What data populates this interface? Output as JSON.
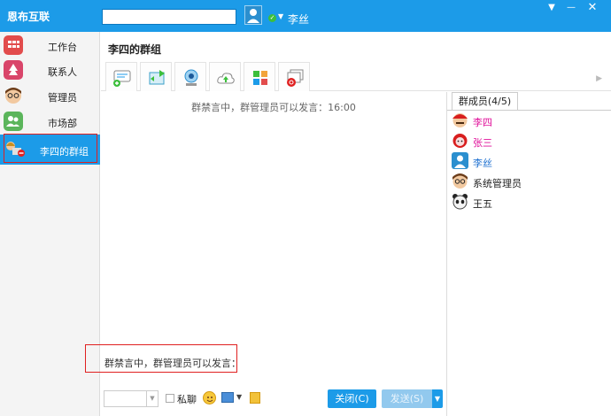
{
  "app": {
    "title": "恩布互联"
  },
  "header": {
    "user_name": "李丝",
    "search_value": ""
  },
  "window": {
    "menu": "▼",
    "minimize": "—",
    "close": "✕"
  },
  "sidebar": {
    "items": [
      {
        "label": "工作台",
        "icon": "grid-app-icon",
        "color": "#e24c4c"
      },
      {
        "label": "联系人",
        "icon": "tree-contacts-icon",
        "color": "#d9456a"
      },
      {
        "label": "管理员",
        "icon": "admin-avatar-icon",
        "color": "#8a5a2b"
      },
      {
        "label": "市场部",
        "icon": "group-people-icon",
        "color": "#5bb55b"
      },
      {
        "label": "李四的群组",
        "icon": "group-forbidden-icon",
        "color": "#1c9be8",
        "active": true
      }
    ]
  },
  "chat": {
    "group_title": "李四的群组",
    "notice": "群禁言中，群管理员可以发言：16:00",
    "input_text": "群禁言中，群管理员可以发言：",
    "toolbar": [
      "new-chat-icon",
      "transfer-file-icon",
      "webcam-icon",
      "upload-cloud-icon",
      "apps-grid-icon",
      "screen-share-icon"
    ]
  },
  "bottom": {
    "font_value": "",
    "private_label": "私聊",
    "close_label": "关闭(C)",
    "send_label": "发送(S)"
  },
  "members": {
    "tab_label": "群成员(4/5)",
    "list": [
      {
        "name": "李四",
        "color": "#e0109a",
        "avatar": "mario-avatar-icon"
      },
      {
        "name": "张三",
        "color": "#e0109a",
        "avatar": "red-hair-avatar-icon"
      },
      {
        "name": "李丝",
        "color": "#1c6fd0",
        "avatar": "default-user-avatar-icon"
      },
      {
        "name": "系统管理员",
        "color": "#222222",
        "avatar": "glasses-avatar-icon"
      },
      {
        "name": "王五",
        "color": "#222222",
        "avatar": "panda-avatar-icon"
      }
    ]
  },
  "colors": {
    "accent": "#1c9be8",
    "highlight_box": "#e02020"
  }
}
